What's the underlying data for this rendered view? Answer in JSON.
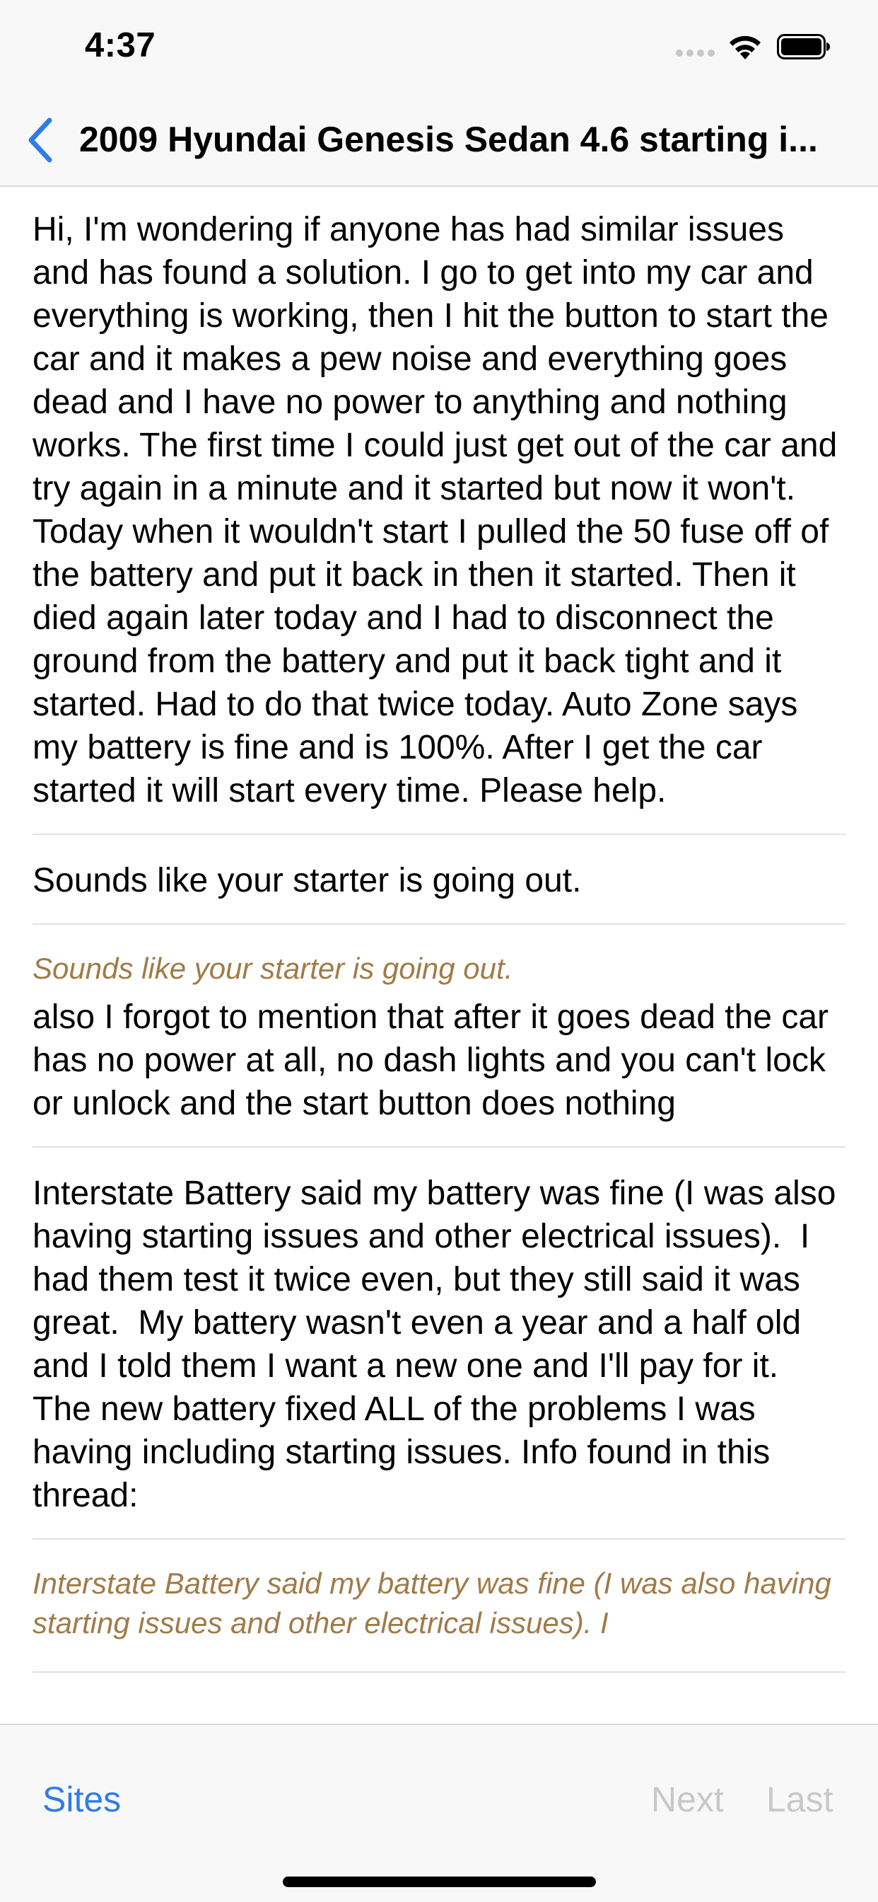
{
  "status_bar": {
    "time": "4:37",
    "icons": [
      "cellular-signal-icon",
      "wifi-icon",
      "battery-icon"
    ]
  },
  "nav": {
    "back_icon": "chevron-left-icon",
    "title": "2009 Hyundai Genesis Sedan 4.6 starting i..."
  },
  "posts": [
    {
      "quote": "",
      "body": "Hi, I'm wondering if anyone has had similar issues and has found a solution. I go to get into my car and everything is working, then I hit the button to start the car and it makes a pew noise and everything goes dead and I have no power to anything and nothing works. The first time I could just get out of the car and try again in a minute and it started but now it won't. Today when it wouldn't start I pulled the 50 fuse off of the battery and put it back in then it started. Then it died again later today and I had to disconnect the ground from the battery and put it back tight and it started. Had to do that twice today. Auto Zone says my battery is fine and is 100%. After I get the car started it will start every time. Please help."
    },
    {
      "quote": "",
      "body": "Sounds like your starter is going out."
    },
    {
      "quote": "Sounds like your starter is going out.",
      "body": "also I forgot to mention that after it goes dead the car has no power at all, no dash lights and you can't lock or unlock and the start button does nothing"
    },
    {
      "quote": "",
      "body": "Interstate Battery said my battery was fine (I was also having starting issues and other electrical issues).  I had them test it twice even, but they still said it was great.  My battery wasn't even a year and a half old and I told them I want a new one and I'll pay for it.  The new battery fixed ALL of the problems I was having including starting issues. Info found in this thread:"
    },
    {
      "quote": "Interstate Battery said my battery was fine (I was also having starting issues and other electrical issues).  I",
      "body": ""
    }
  ],
  "toolbar": {
    "sites_label": "Sites",
    "next_label": "Next",
    "last_label": "Last"
  },
  "colors": {
    "accent": "#2f7ce5",
    "quote": "#a07b47",
    "disabled": "#c8c8c8",
    "bar_background": "#f8f8f8"
  }
}
